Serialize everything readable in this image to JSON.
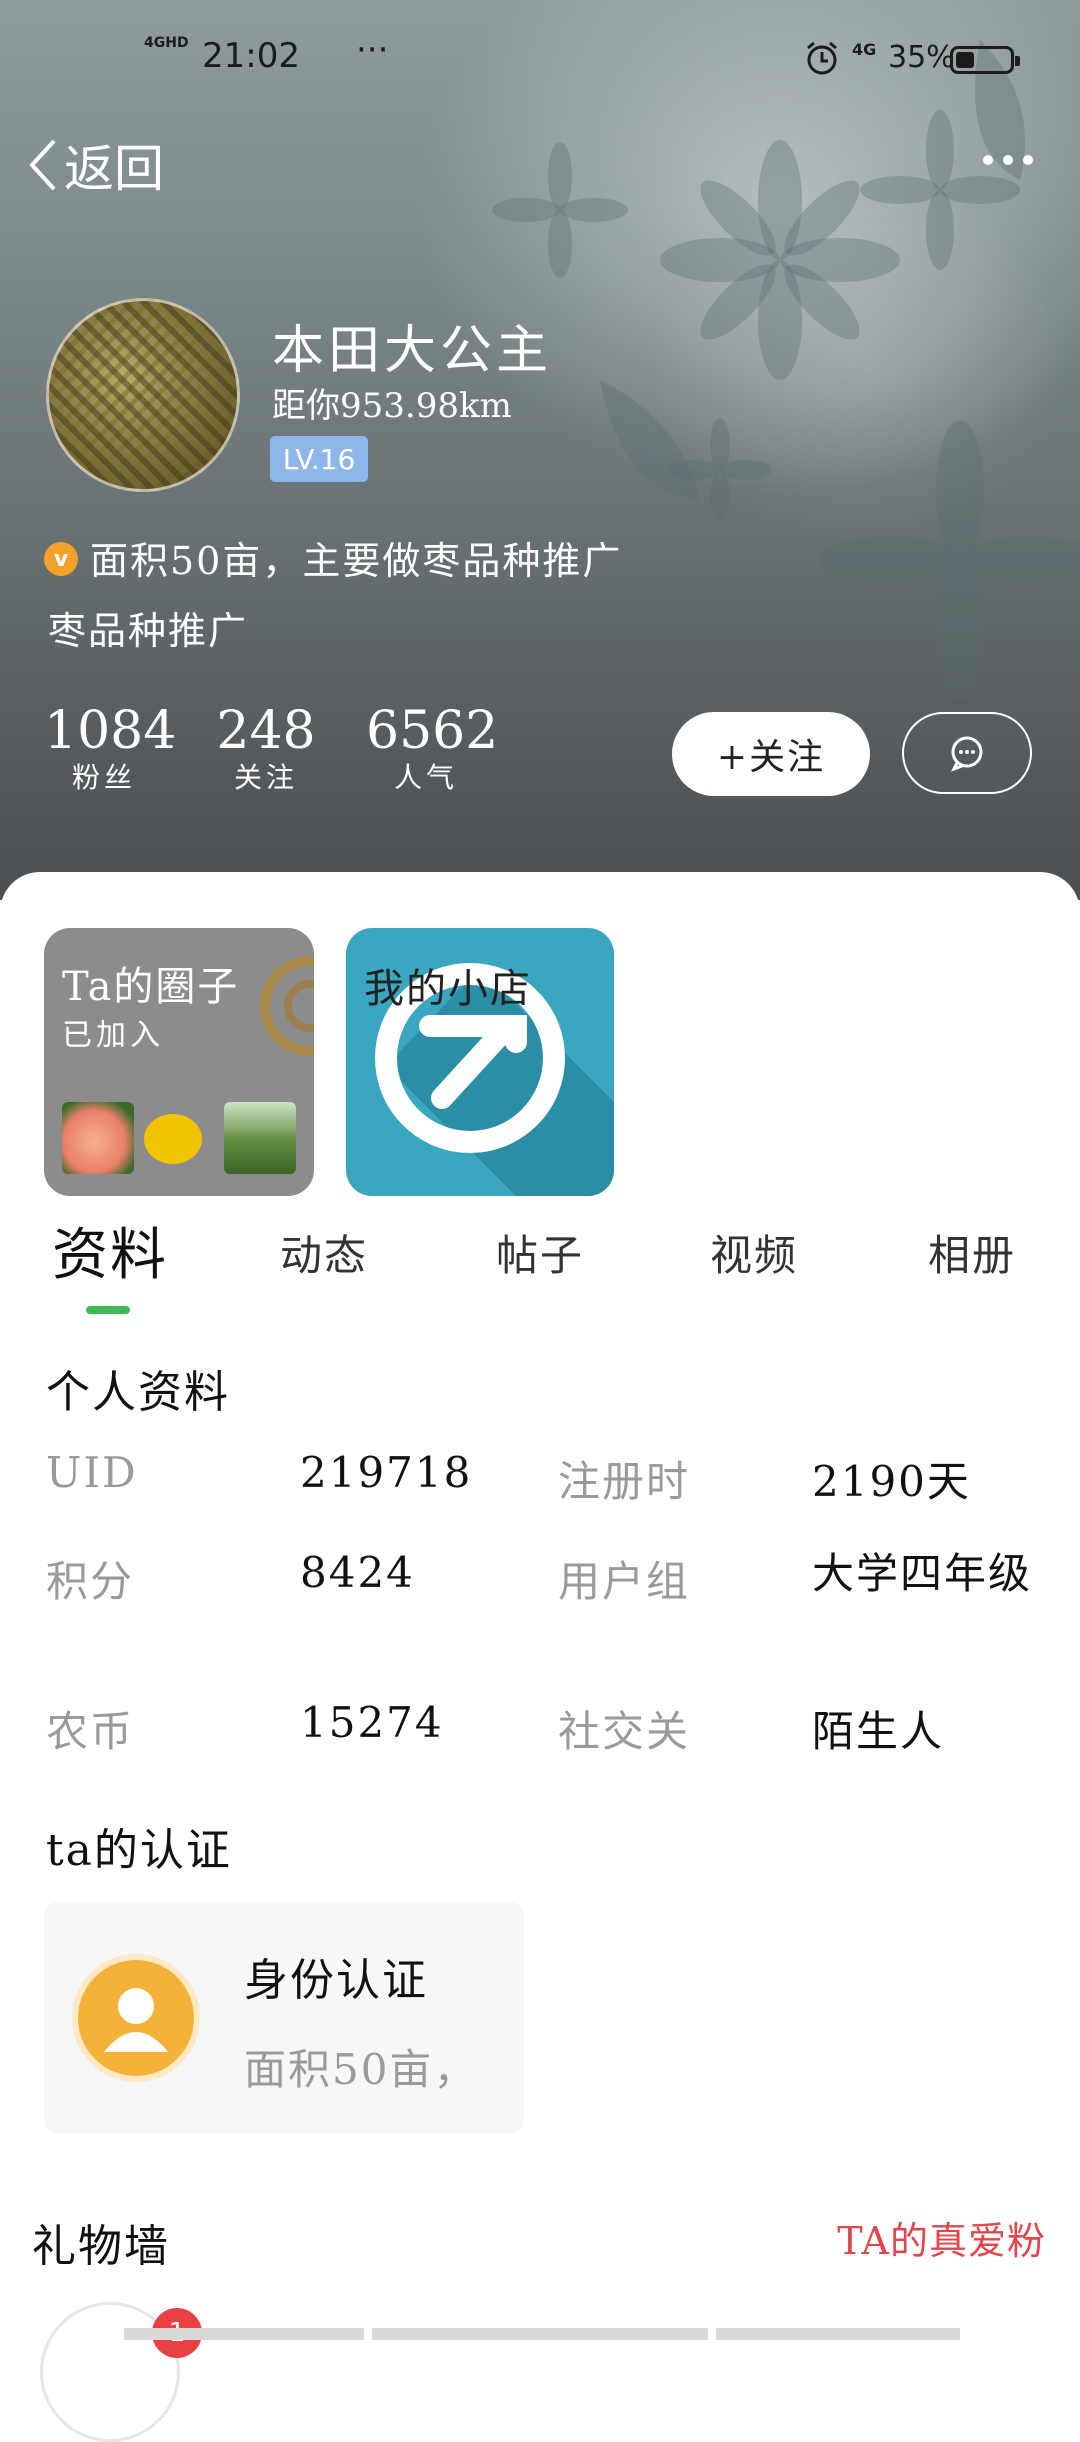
{
  "status_bar": {
    "signal": "4GHD",
    "time": "21:02",
    "extra": "···",
    "network": "4G",
    "battery_text": "35%",
    "battery_level": 0.35
  },
  "nav": {
    "back_label": "返回"
  },
  "profile": {
    "nickname": "本田大公主",
    "distance": "距你953.98km",
    "level": "LV.16",
    "signature_badge": "v",
    "signature": "面积50亩，主要做枣品种推广",
    "signature_line2": "枣品种推广"
  },
  "stats": [
    {
      "value": "1084",
      "label": "粉丝"
    },
    {
      "value": "248",
      "label": "关注"
    },
    {
      "value": "6562",
      "label": "人气"
    }
  ],
  "actions": {
    "follow_label": "+关注"
  },
  "tiles": {
    "circle": {
      "title": "Ta的圈子",
      "subtitle": "已加入"
    },
    "shop": {
      "title": "我的小店"
    }
  },
  "tabs": [
    "资料",
    "动态",
    "帖子",
    "视频",
    "相册"
  ],
  "profile_info": {
    "title": "个人资料",
    "rows": [
      {
        "k1": "UID",
        "v1": "219718",
        "k2": "注册时",
        "v2": "2190天"
      },
      {
        "k1": "积分",
        "v1": "8424",
        "k2": "用户组",
        "v2": "大学四年级"
      },
      {
        "k1": "农币",
        "v1": "15274",
        "k2": "社交关",
        "v2": "陌生人"
      }
    ]
  },
  "certification": {
    "title": "ta的认证",
    "card_title": "身份认证",
    "card_desc": "面积50亩，"
  },
  "gift_wall": {
    "title": "礼物墙",
    "link": "TA的真爱粉",
    "badge_count": "1"
  },
  "colors": {
    "accent_green": "#3cb95a",
    "level_blue": "#8fb6e8",
    "link_red": "#e0474c",
    "cert_orange": "#f4b23a"
  }
}
